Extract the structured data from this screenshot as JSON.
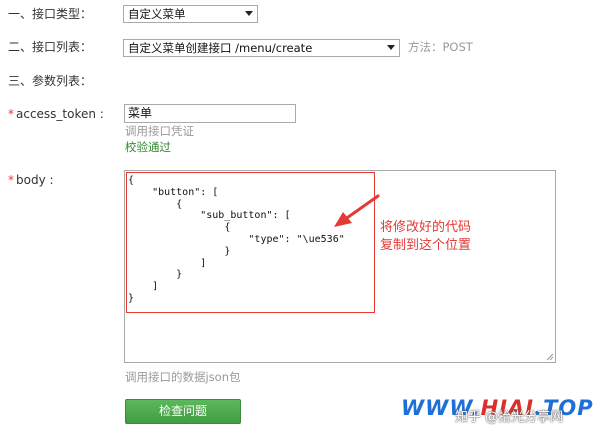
{
  "form": {
    "interface_type": {
      "label": "一、接口类型：",
      "selected": "自定义菜单"
    },
    "interface_list": {
      "label": "二、接口列表：",
      "selected": "自定义菜单创建接口 /menu/create",
      "method": "方法：POST"
    },
    "params": {
      "label": "三、参数列表："
    },
    "access_token": {
      "required_mark": "*",
      "label": "access_token :",
      "value": "菜单",
      "hint": "调用接口凭证",
      "status": "校验通过"
    },
    "body": {
      "required_mark": "*",
      "label": "body :",
      "code_lines": [
        "{",
        "    \"button\": [",
        "        {",
        "            \"sub_button\": [",
        "                {",
        "                    \"type\": \"\\ue536\"",
        "                }",
        "            ]",
        "        }",
        "    ]",
        "}"
      ],
      "hint": "调用接口的数据json包"
    },
    "check_button": "检查问题"
  },
  "annotation": {
    "line1": "将修改好的代码",
    "line2": "复制到这个位置"
  },
  "watermark": {
    "brand_blue": "WWW.",
    "brand_red": "HIAI",
    "brand_tail": ".TOP",
    "text": "知乎 @拾光分享网"
  },
  "colors": {
    "required": "#e53935",
    "success": "#2e8b2e",
    "button": "#4cae4c",
    "annotation": "#e53935"
  }
}
